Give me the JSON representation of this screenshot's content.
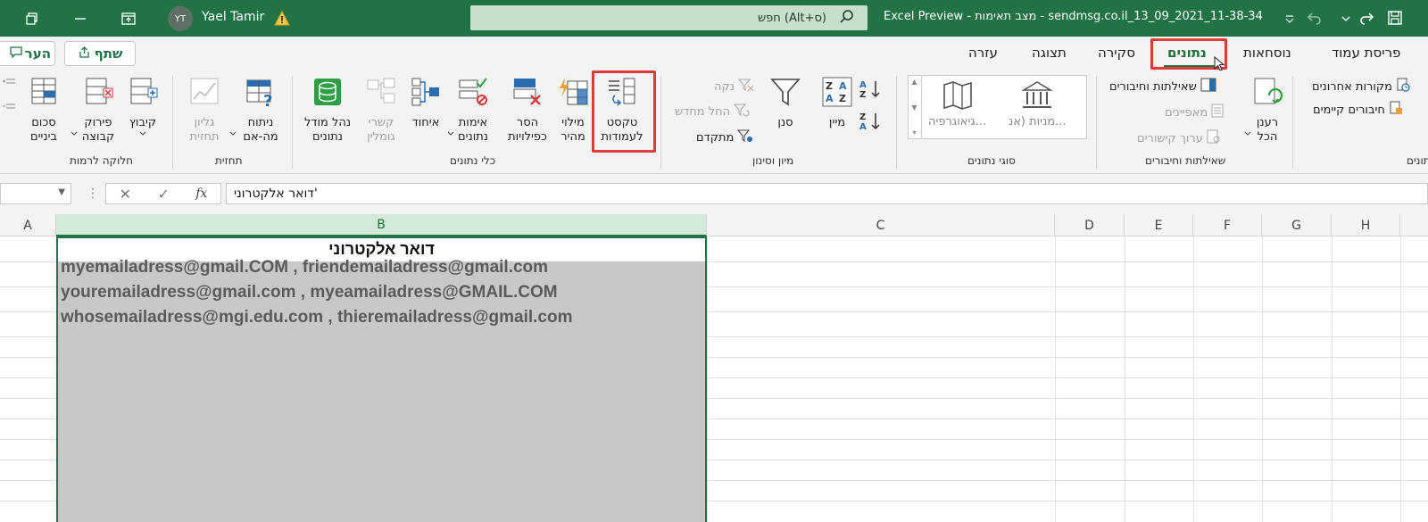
{
  "titlebar": {
    "user_initials": "YT",
    "user_name": "Yael Tamir",
    "search_placeholder": "חפש (Alt+ס)",
    "doc_title": "Excel Preview - מצב תאימות - sendmsg.co.il_13_09_2021_11-38-34"
  },
  "menu": {
    "tabs": [
      "פריסת עמוד",
      "נוסחאות",
      "נתונים",
      "סקירה",
      "תצוגה",
      "עזרה"
    ],
    "active": "נתונים",
    "share_label": "שתף",
    "comment_label": "הער"
  },
  "ribbon": {
    "get_data": {
      "recent_sources": "מקורות אחרונים",
      "existing_connections": "חיבורים קיימים",
      "group_label": "נתונים"
    },
    "queries": {
      "refresh_all": "רענן",
      "refresh_all_2": "הכל",
      "queries_connections": "שאילתות וחיבורים",
      "properties": "מאפיינים",
      "edit_links": "ערוך קישורים",
      "group_label": "שאילתות וחיבורים"
    },
    "data_types": {
      "stocks": "מניות (אנ...",
      "geography": "גיאוגרפיה...",
      "group_label": "סוגי נתונים"
    },
    "sort_filter": {
      "sort": "מיין",
      "filter": "סנן",
      "clear": "נקה",
      "reapply": "החל מחדש",
      "advanced": "מתקדם",
      "group_label": "מיון וסינון"
    },
    "data_tools": {
      "text_to_columns_1": "טקסט",
      "text_to_columns_2": "לעמודות",
      "flash_fill_1": "מילוי",
      "flash_fill_2": "מהיר",
      "remove_duplicates_1": "הסר",
      "remove_duplicates_2": "כפילויות",
      "data_validation_1": "אימות",
      "data_validation_2": "נתונים",
      "consolidate": "איחוד",
      "relationships_1": "קשרי",
      "relationships_2": "גומלין",
      "data_model_1": "נהל מודל",
      "data_model_2": "נתונים",
      "group_label": "כלי נתונים"
    },
    "forecast": {
      "what_if_1": "ניתוח",
      "what_if_2": "מה-אם",
      "forecast_sheet_1": "גליון",
      "forecast_sheet_2": "תחזית",
      "group_label": "תחזית"
    },
    "outline": {
      "group": "קיבוץ",
      "ungroup_1": "פירוק",
      "ungroup_2": "קבוצה",
      "subtotal_1": "סכום",
      "subtotal_2": "ביניים",
      "group_label": "חלוקה לרמות"
    }
  },
  "formula": {
    "fx": "fx",
    "content": "דואר אלקטרוני'"
  },
  "columns": [
    "A",
    "B",
    "C",
    "D",
    "E",
    "F",
    "G",
    "H"
  ],
  "sheet": {
    "header": "דואר אלקטרוני",
    "rows": [
      "myemailadress@gmail.COM , friendemailadress@gmail.com",
      "youremailadress@gmail.com , myeamailadress@GMAIL.COM",
      "whosemailadress@mgi.edu.com , thieremailadress@gmail.com"
    ]
  }
}
